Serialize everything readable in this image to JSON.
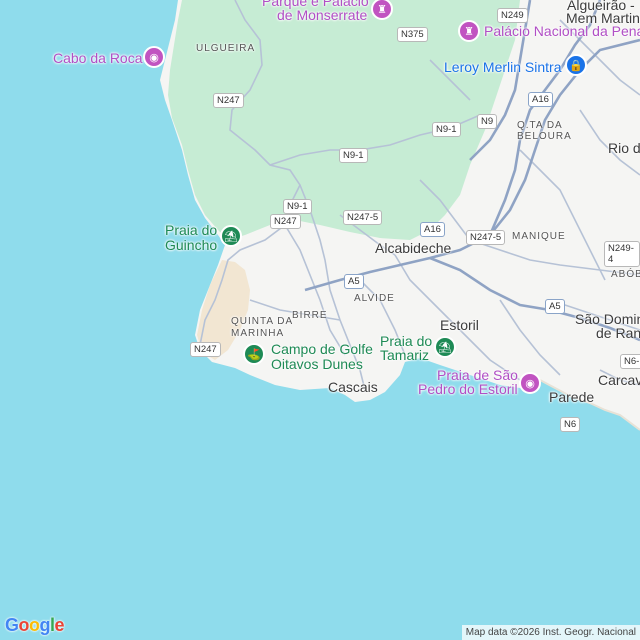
{
  "colors": {
    "sea": "#8fdcec",
    "land": "#f5f5f3",
    "park": "#c6ecd4",
    "sand": "#f2e6d2",
    "road": "#b6c2d6",
    "highway": "#8fa3c4"
  },
  "places": {
    "algueirao": "Algueirão -",
    "mem_martins": "Mem Martins",
    "rio_de": "Rio de",
    "alcabideche": "Alcabideche",
    "estoril": "Estoril",
    "cascais": "Cascais",
    "parede": "Parede",
    "carcavelos": "Carcav",
    "sao_domingos_1": "São Domin",
    "sao_domingos_2": "de Ran"
  },
  "localities": {
    "ulgueira": "ULGUEIRA",
    "qta_beloura_1": "Q.TA DA",
    "qta_beloura_2": "BELOURA",
    "manique": "MANIQUE",
    "abobora": "ABÓBO",
    "alvide": "ALVIDE",
    "birre": "BIRRE",
    "quinta_marinha_1": "QUINTA DA",
    "quinta_marinha_2": "MARINHA"
  },
  "pois": {
    "monserrate_1": "Parque e Palácio",
    "monserrate_2": "de Monserrate",
    "pena": "Palácio Nacional da Pena",
    "leroy": "Leroy Merlin Sintra",
    "cabo_roca": "Cabo da Roca",
    "guincho_1": "Praia do",
    "guincho_2": "Guincho",
    "tamariz_1": "Praia do",
    "tamariz_2": "Tamariz",
    "golfe_1": "Campo de Golfe",
    "golfe_2": "Oitavos Dunes",
    "sao_pedro_1": "Praia de São",
    "sao_pedro_2": "Pedro do Estoril"
  },
  "roads": {
    "n249": "N249",
    "n375": "N375",
    "n247_a": "N247",
    "a16_a": "A16",
    "n9": "N9",
    "n9_1_a": "N9-1",
    "n9_1_b": "N9-1",
    "n9_1_c": "N9-1",
    "n247_b": "N247",
    "n247_5_a": "N247-5",
    "a16_b": "A16",
    "n247_5_b": "N247-5",
    "n249_4": "N249-4",
    "a5_a": "A5",
    "a5_b": "A5",
    "n247_c": "N247",
    "n6": "N6",
    "n6_partial": "N6-"
  },
  "footer": {
    "logo_letters": [
      "G",
      "o",
      "o",
      "g",
      "l",
      "e"
    ],
    "logo_colors": [
      "#4285f4",
      "#ea4335",
      "#fbbc05",
      "#4285f4",
      "#34a853",
      "#ea4335"
    ],
    "attribution": "Map data ©2026 Inst. Geogr. Nacional"
  }
}
